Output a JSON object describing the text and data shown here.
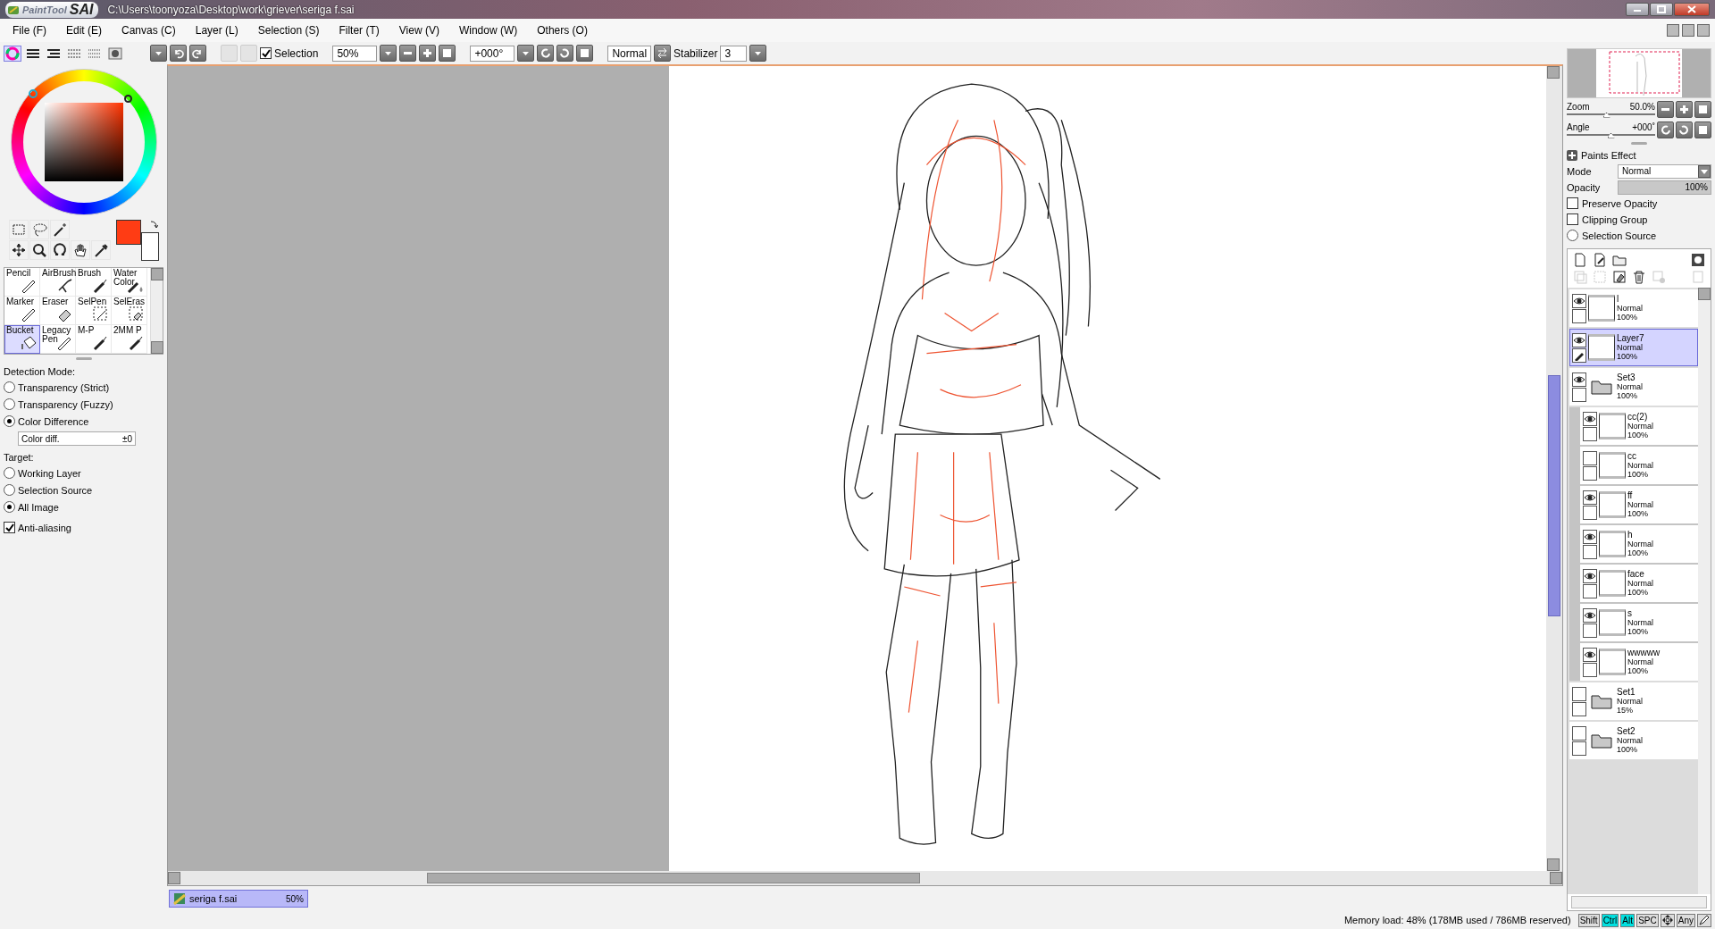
{
  "window": {
    "logo": [
      "PaintTool",
      "SAI"
    ],
    "title": "C:\\Users\\toonyoza\\Desktop\\work\\griever\\seriga f.sai"
  },
  "menu": [
    "File (F)",
    "Edit (E)",
    "Canvas (C)",
    "Layer (L)",
    "Selection (S)",
    "Filter (T)",
    "View (V)",
    "Window (W)",
    "Others (O)"
  ],
  "color_panel_tabs": [
    {
      "kind": "wheel",
      "selected": true
    },
    {
      "kind": "rgb",
      "selected": false
    },
    {
      "kind": "hsv",
      "selected": false
    },
    {
      "kind": "sliders",
      "selected": false
    },
    {
      "kind": "swatches",
      "selected": false
    },
    {
      "kind": "scratch",
      "selected": false
    }
  ],
  "toolbar": {
    "selection": {
      "label": "Selection",
      "checked": true
    },
    "zoom": "50%",
    "angle": "+000°",
    "blend": "Normal",
    "stabilizer_label": "Stabilizer",
    "stabilizer": "3"
  },
  "swatches": [
    {
      "kind": "primary",
      "color": "#ff3c14"
    },
    {
      "kind": "secondary",
      "color": "#ffffff"
    }
  ],
  "tools": [
    {
      "label": "Pencil",
      "kind": "pencil",
      "selected": false
    },
    {
      "label": "AirBrush",
      "kind": "airbrush",
      "selected": false
    },
    {
      "label": "Brush",
      "kind": "brush",
      "selected": false
    },
    {
      "label": "Water Color",
      "kind": "water",
      "selected": false
    },
    {
      "label": "Marker",
      "kind": "pencil",
      "selected": false
    },
    {
      "label": "Eraser",
      "kind": "eraser",
      "selected": false
    },
    {
      "label": "SelPen",
      "kind": "selpen",
      "selected": false
    },
    {
      "label": "SelEras",
      "kind": "seleras",
      "selected": false
    },
    {
      "label": "Bucket",
      "kind": "bucket",
      "selected": true
    },
    {
      "label": "Legacy Pen",
      "kind": "pencil",
      "selected": false
    },
    {
      "label": "M-P",
      "kind": "brush",
      "selected": false
    },
    {
      "label": "2MM P",
      "kind": "brush",
      "selected": false
    }
  ],
  "detection": {
    "label": "Detection Mode:",
    "options": [
      {
        "label": "Transparency (Strict)",
        "selected": false
      },
      {
        "label": "Transparency (Fuzzy)",
        "selected": false
      },
      {
        "label": "Color Difference",
        "selected": true
      }
    ],
    "field": {
      "label": "Color diff.",
      "value": "±0"
    }
  },
  "target": {
    "label": "Target:",
    "options": [
      {
        "label": "Working Layer",
        "selected": false
      },
      {
        "label": "Selection Source",
        "selected": false
      },
      {
        "label": "All Image",
        "selected": true
      }
    ]
  },
  "antialiasing": {
    "label": "Anti-aliasing",
    "checked": true
  },
  "document_tabs": [
    {
      "name": "seriga f.sai",
      "zoom": "50%",
      "selected": true
    }
  ],
  "navigator": {
    "zoom": {
      "label": "Zoom",
      "reading": "50.0%",
      "level": 0.45
    },
    "angle": {
      "label": "Angle",
      "reading": "+000˚",
      "level": 0.5
    }
  },
  "layer_properties": {
    "paints_effect": "Paints Effect",
    "mode_label": "Mode",
    "mode": "Normal",
    "opacity": {
      "label": "Opacity",
      "reading": "100%",
      "level": 1
    },
    "options": [
      {
        "kind": "checkbox",
        "label": "Preserve Opacity",
        "checked": false
      },
      {
        "kind": "checkbox",
        "label": "Clipping Group",
        "checked": false
      },
      {
        "kind": "radio",
        "label": "Selection Source",
        "checked": false
      }
    ]
  },
  "layers": [
    {
      "kind": "layer",
      "name": "l",
      "mode": "Normal",
      "opacity": "100%",
      "visible": true,
      "selected": false
    },
    {
      "kind": "layer",
      "name": "Layer7",
      "mode": "Normal",
      "opacity": "100%",
      "visible": true,
      "selected": true
    },
    {
      "kind": "folder",
      "name": "Set3",
      "mode": "Normal",
      "opacity": "100%",
      "visible": true,
      "selected": false,
      "children": [
        {
          "kind": "layer",
          "name": "cc(2)",
          "mode": "Normal",
          "opacity": "100%",
          "visible": true,
          "selected": false
        },
        {
          "kind": "layer",
          "name": "cc",
          "mode": "Normal",
          "opacity": "100%",
          "visible": false,
          "selected": false
        },
        {
          "kind": "layer",
          "name": "ff",
          "mode": "Normal",
          "opacity": "100%",
          "visible": true,
          "selected": false
        },
        {
          "kind": "layer",
          "name": "h",
          "mode": "Normal",
          "opacity": "100%",
          "visible": true,
          "selected": false
        },
        {
          "kind": "layer",
          "name": "face",
          "mode": "Normal",
          "opacity": "100%",
          "visible": true,
          "selected": false
        },
        {
          "kind": "layer",
          "name": "s",
          "mode": "Normal",
          "opacity": "100%",
          "visible": true,
          "selected": false
        },
        {
          "kind": "layer",
          "name": "wwwww",
          "mode": "Normal",
          "opacity": "100%",
          "visible": true,
          "selected": false
        }
      ]
    },
    {
      "kind": "folder",
      "name": "Set1",
      "mode": "Normal",
      "opacity": "15%",
      "visible": false,
      "selected": false
    },
    {
      "kind": "folder",
      "name": "Set2",
      "mode": "Normal",
      "opacity": "100%",
      "visible": false,
      "selected": false
    }
  ],
  "status_bar": {
    "memory": "Memory load: 48% (178MB used / 786MB reserved)",
    "keys": [
      {
        "kind": "text",
        "label": "Shift",
        "on": false
      },
      {
        "kind": "text",
        "label": "Ctrl",
        "on": true
      },
      {
        "kind": "text",
        "label": "Alt",
        "on": true
      },
      {
        "kind": "text",
        "label": "SPC",
        "on": false
      },
      {
        "kind": "move",
        "on": false
      },
      {
        "kind": "text",
        "label": "Any",
        "on": false
      },
      {
        "kind": "pen",
        "on": false
      }
    ]
  }
}
